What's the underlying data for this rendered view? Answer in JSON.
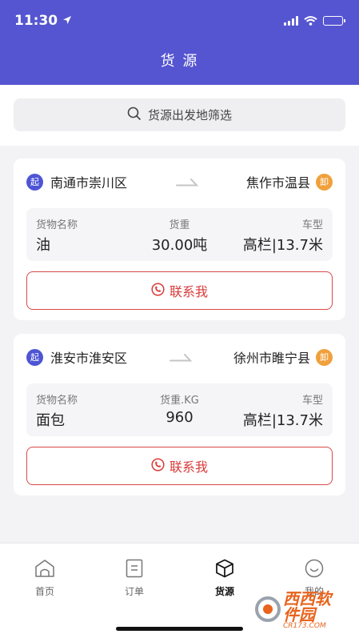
{
  "status_bar": {
    "time": "11:30"
  },
  "header": {
    "title": "货 源"
  },
  "search": {
    "placeholder": "货源出发地筛选"
  },
  "shipments": [
    {
      "start_tag": "起",
      "origin": "南通市崇川区",
      "end_tag": "卸",
      "destination": "焦作市温县",
      "cargo_name_label": "货物名称",
      "cargo_name": "油",
      "weight_label": "货重",
      "weight": "30.00吨",
      "vehicle_label": "车型",
      "vehicle": "高栏|13.7米",
      "contact_label": "联系我"
    },
    {
      "start_tag": "起",
      "origin": "淮安市淮安区",
      "end_tag": "卸",
      "destination": "徐州市睢宁县",
      "cargo_name_label": "货物名称",
      "cargo_name": "面包",
      "weight_label": "货重.KG",
      "weight": "960",
      "vehicle_label": "车型",
      "vehicle": "高栏|13.7米",
      "contact_label": "联系我"
    }
  ],
  "tabbar": {
    "items": [
      {
        "label": "首页",
        "icon": "home-icon"
      },
      {
        "label": "订单",
        "icon": "order-icon"
      },
      {
        "label": "货源",
        "icon": "box-icon",
        "active": true
      },
      {
        "label": "我的",
        "icon": "smile-icon"
      }
    ]
  },
  "watermark": {
    "main": "西西软件园",
    "sub": "CR173.COM"
  },
  "colors": {
    "brand": "#5555d1",
    "accent_red": "#d93a3a",
    "end_tag": "#f0a03c"
  }
}
